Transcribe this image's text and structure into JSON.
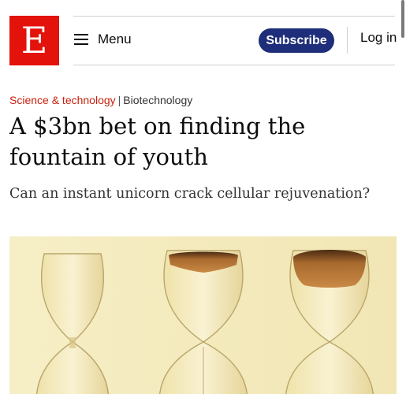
{
  "header": {
    "logo_letter": "E",
    "menu_label": "Menu",
    "subscribe_label": "Subscribe",
    "login_label": "Log in"
  },
  "breadcrumb": {
    "section": "Science & technology",
    "separator": "|",
    "subsection": "Biotechnology"
  },
  "article": {
    "headline": "A $3bn bet on finding the fountain of youth",
    "standfirst": "Can an instant unicorn crack cellular rejuvenation?"
  },
  "colors": {
    "brand_red": "#e3120b",
    "subscribe_blue": "#1f2e7a",
    "section_red": "#c8200e",
    "image_background": "#f5ecbf"
  },
  "icons": [
    "hamburger-icon"
  ]
}
